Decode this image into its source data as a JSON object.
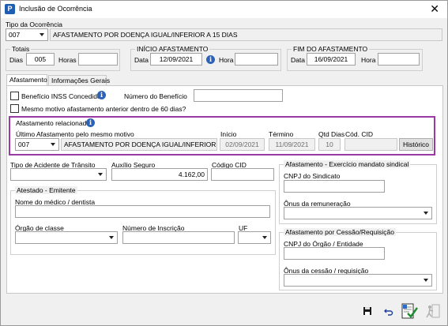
{
  "window": {
    "title": "Inclusão de Ocorrência",
    "close": "✕"
  },
  "tipo_ocorrencia": {
    "label": "Tipo da Ocorrência",
    "code": "007",
    "description": "AFASTAMENTO POR DOENÇA IGUAL/INFERIOR A 15 DIAS"
  },
  "totais": {
    "label": "Totais",
    "dias_label": "Dias",
    "dias_value": "005",
    "horas_label": "Horas",
    "horas_value": ""
  },
  "inicio": {
    "label": "INÍCIO AFASTAMENTO",
    "data_label": "Data",
    "data_value": "12/09/2021",
    "hora_label": "Hora",
    "hora_value": ""
  },
  "fim": {
    "label": "FIM DO AFASTAMENTO",
    "data_label": "Data",
    "data_value": "16/09/2021",
    "hora_label": "Hora",
    "hora_value": ""
  },
  "tabs": [
    {
      "label": "Afastamento"
    },
    {
      "label": "Informações Gerais"
    }
  ],
  "beneficio": {
    "inss_label": "Benefício INSS Concedido?",
    "numero_label": "Número do Benefício",
    "numero_value": ""
  },
  "mesmo_motivo": {
    "label": "Mesmo motivo afastamento anterior dentro de 60 dias?"
  },
  "relacionado": {
    "label": "Afastamento relacionado",
    "ultimo_label": "Último Afastamento pelo mesmo motivo",
    "code": "007",
    "description": "AFASTAMENTO POR DOENÇA IGUAL/INFERIOR A 15 DIAS",
    "inicio_label": "Início",
    "inicio_value": "02/09/2021",
    "termino_label": "Término",
    "termino_value": "11/09/2021",
    "qtd_label": "Qtd Dias",
    "qtd_value": "10",
    "cid_label": "Cód. CID",
    "cid_value": "",
    "historico_label": "Histórico"
  },
  "transito": {
    "label": "Tipo de Acidente de Trânsito",
    "value": ""
  },
  "auxilio": {
    "label": "Auxílio Seguro",
    "value": "4.162,00"
  },
  "codigo_cid": {
    "label": "Código CID",
    "value": ""
  },
  "atestado": {
    "label": "Atestado - Emitente",
    "medico_label": "Nome do médico / dentista",
    "medico_value": "",
    "orgao_label": "Órgão de classe",
    "orgao_value": "",
    "inscricao_label": "Número de Inscrição",
    "inscricao_value": "",
    "uf_label": "UF",
    "uf_value": ""
  },
  "sindical": {
    "label": "Afastamento - Exercício mandato sindical",
    "cnpj_label": "CNPJ do Sindicato",
    "cnpj_value": "",
    "onus_label": "Ônus da remuneração",
    "onus_value": ""
  },
  "cessao": {
    "label": "Afastamento por Cessão/Requisição",
    "cnpj_label": "CNPJ do Órgão / Entidade",
    "cnpj_value": "",
    "onus_label": "Ônus da cessão / requisição",
    "onus_value": ""
  },
  "icons": {
    "info": "info-icon",
    "save": "floppy-disk-icon",
    "undo": "undo-arrow-icon",
    "confirm": "document-check-icon",
    "exit": "person-exit-icon"
  },
  "colors": {
    "highlight": "#9b3aa6",
    "info": "#2c63b8"
  }
}
